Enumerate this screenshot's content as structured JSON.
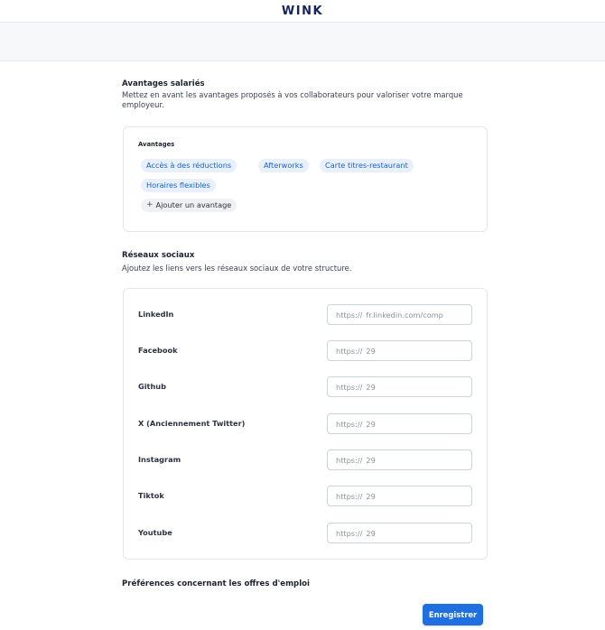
{
  "header": {
    "logo": "WINK"
  },
  "benefits": {
    "title": "Avantages salariés",
    "description": "Mettez en avant les avantages proposés à vos collaborateurs pour valoriser votre marque employeur.",
    "card_label": "Avantages",
    "chips": [
      "Accès à des réductions",
      "Afterworks",
      "Carte titres-restaurant",
      "Horaires flexibles"
    ],
    "add_label": "Ajouter un avantage"
  },
  "social": {
    "title": "Réseaux sociaux",
    "description": "Ajoutez les liens vers les réseaux sociaux de votre structure.",
    "fields": [
      {
        "label": "LinkedIn",
        "prefix": "https://",
        "value": "fr.linkedin.com/comp"
      },
      {
        "label": "Facebook",
        "prefix": "https://",
        "value": "29"
      },
      {
        "label": "Github",
        "prefix": "https://",
        "value": "29"
      },
      {
        "label": "X (Anciennement Twitter)",
        "prefix": "https://",
        "value": "29"
      },
      {
        "label": "Instagram",
        "prefix": "https://",
        "value": "29"
      },
      {
        "label": "Tiktok",
        "prefix": "https://",
        "value": "29"
      },
      {
        "label": "Youtube",
        "prefix": "https://",
        "value": "29"
      }
    ]
  },
  "job_prefs": {
    "title": "Préférences concernant les offres d'emploi"
  },
  "actions": {
    "save_label": "Enregistrer"
  }
}
